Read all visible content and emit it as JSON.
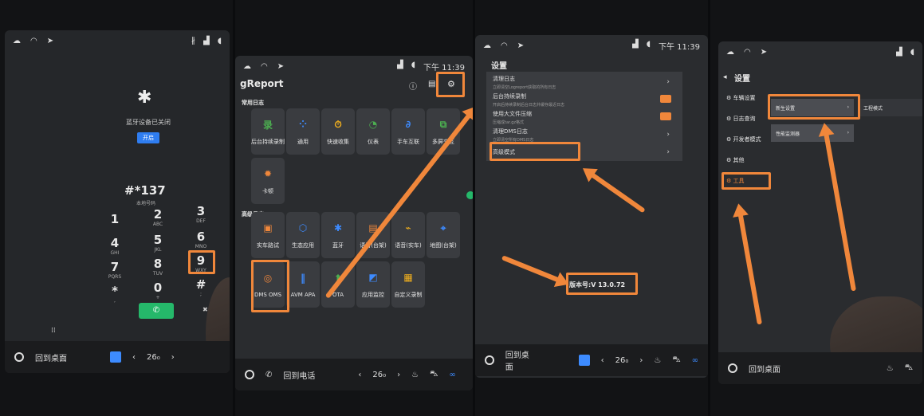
{
  "panel1": {
    "bt_off_text": "蓝牙设备已关闭",
    "enable_button": "开启",
    "dialed": "#*137",
    "dialed_sub": "本地号码",
    "keys": [
      {
        "d": "1",
        "l": ""
      },
      {
        "d": "2",
        "l": "ABC"
      },
      {
        "d": "3",
        "l": "DEF"
      },
      {
        "d": "4",
        "l": "GHI"
      },
      {
        "d": "5",
        "l": "JKL"
      },
      {
        "d": "6",
        "l": "MNO"
      },
      {
        "d": "7",
        "l": "PQRS"
      },
      {
        "d": "8",
        "l": "TUV"
      },
      {
        "d": "9",
        "l": "WXY"
      },
      {
        "d": "*",
        "l": ","
      },
      {
        "d": "0",
        "l": "+"
      },
      {
        "d": "#",
        "l": ";"
      }
    ],
    "dock_home": "回到桌面",
    "dock_temp": "26₀",
    "delete_symbol": "✖"
  },
  "panel2": {
    "status_time": "下午 11:39",
    "app_title": "gReport",
    "section_common": "常用日志",
    "common_tiles": [
      {
        "label": "后台持续录制",
        "icon": "录",
        "color": "#4caf50"
      },
      {
        "label": "通用",
        "icon": "⁘",
        "color": "#3d8bff"
      },
      {
        "label": "快速收集",
        "icon": "⏱",
        "color": "#f2b01e"
      },
      {
        "label": "仪表",
        "icon": "◔",
        "color": "#4caf50"
      },
      {
        "label": "手车互联",
        "icon": "∂",
        "color": "#3d8bff"
      },
      {
        "label": "多屏交互",
        "icon": "⧉",
        "color": "#4caf50"
      },
      {
        "label": "卡顿",
        "icon": "✹",
        "color": "#f0873b"
      }
    ],
    "section_advanced": "高级日志",
    "advanced_tiles": [
      {
        "label": "实车路试",
        "icon": "▣",
        "color": "#f0873b"
      },
      {
        "label": "生态应用",
        "icon": "⬡",
        "color": "#3d8bff"
      },
      {
        "label": "蓝牙",
        "icon": "✱",
        "color": "#3d8bff"
      },
      {
        "label": "语音(台架)",
        "icon": "▤",
        "color": "#f0873b"
      },
      {
        "label": "语音(实车)",
        "icon": "⌁",
        "color": "#f2b01e"
      },
      {
        "label": "地图(台架)",
        "icon": "⌖",
        "color": "#3d8bff"
      },
      {
        "label": "DMS OMS",
        "icon": "◎",
        "color": "#f0873b"
      },
      {
        "label": "AVM APA",
        "icon": "‖",
        "color": "#3d8bff"
      },
      {
        "label": "OTA",
        "icon": "⬆",
        "color": "#4caf50"
      },
      {
        "label": "应用监控",
        "icon": "◩",
        "color": "#3d8bff"
      },
      {
        "label": "自定义录制",
        "icon": "▦",
        "color": "#f2b01e"
      }
    ],
    "dock_call": "回到电话",
    "dock_temp": "26₀"
  },
  "panel3": {
    "status_time": "下午 11:39",
    "title": "设置",
    "rows": [
      {
        "title": "清理日志",
        "sub": "立即清空Logreport获取的所有日志",
        "control": "chevron"
      },
      {
        "title": "后台持续录制",
        "sub": "开启后持续录制后台日志并缓存最近日志",
        "control": "toggle"
      },
      {
        "title": "使用大文件压缩",
        "sub": "压缩成tar.gz格式",
        "control": "toggle"
      },
      {
        "title": "清理DMS日志",
        "sub": "立即清空所有DMS日志",
        "control": "chevron"
      },
      {
        "title": "高级模式",
        "sub": "",
        "control": "chevron"
      }
    ],
    "version": "版本号:V 13.0.72",
    "dock_home": "回到桌面",
    "dock_temp": "26₀"
  },
  "panel4": {
    "title": "设置",
    "side_items": [
      "车辆设置",
      "日志查询",
      "开发者模式",
      "其他",
      "工具"
    ],
    "tool_buttons": [
      "新生设置",
      "工程模式",
      "性能监测器"
    ],
    "dock_home": "回到桌面"
  },
  "accent_color": "#f0873b"
}
